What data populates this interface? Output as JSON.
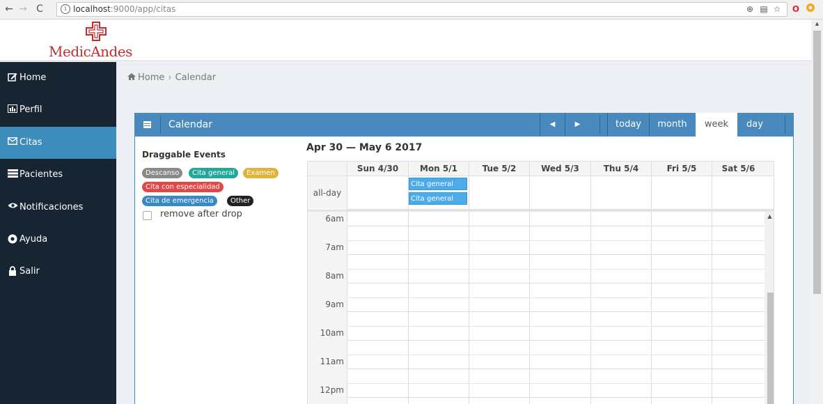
{
  "browser": {
    "url_host": "localhost",
    "url_path": ":9000/app/citas",
    "info_glyph": "i"
  },
  "brand": {
    "name": "MedicAndes",
    "accent_color": "#c42b2b"
  },
  "sidebar": {
    "items": [
      {
        "label": "Home",
        "icon": "edit-icon"
      },
      {
        "label": "Perfil",
        "icon": "bar-chart-icon"
      },
      {
        "label": "Citas",
        "icon": "envelope-icon",
        "active": true
      },
      {
        "label": "Pacientes",
        "icon": "list-icon"
      },
      {
        "label": "Notificaciones",
        "icon": "eye-icon"
      },
      {
        "label": "Ayuda",
        "icon": "life-ring-icon"
      },
      {
        "label": "Salir",
        "icon": "lock-icon"
      }
    ]
  },
  "breadcrumb": {
    "home": "Home",
    "separator": "›",
    "current": "Calendar"
  },
  "calendar_panel": {
    "title": "Calendar",
    "prev_glyph": "◀",
    "next_glyph": "▶",
    "today": "today",
    "month": "month",
    "week": "week",
    "day": "day",
    "active_view": "week",
    "header_color": "#4a89be"
  },
  "draggable": {
    "title": "Draggable Events",
    "events": [
      {
        "label": "Descanso",
        "color": "#8a8a8a"
      },
      {
        "label": "Cita general",
        "color": "#20a99a"
      },
      {
        "label": "Examen",
        "color": "#e0b43a"
      },
      {
        "label": "Cita con especialidad",
        "color": "#e04848"
      },
      {
        "label": "Cita de emergencia",
        "color": "#3a89c4"
      },
      {
        "label": "Other",
        "color": "#222222"
      }
    ],
    "remove_label": "remove after drop"
  },
  "calendar": {
    "range_title": "Apr 30 — May 6 2017",
    "days": [
      "Sun 4/30",
      "Mon 5/1",
      "Tue 5/2",
      "Wed 5/3",
      "Thu 5/4",
      "Fri 5/5",
      "Sat 5/6"
    ],
    "allday_label": "all-day",
    "allday_events": [
      {
        "day": "Mon 5/1",
        "label": "Cita general"
      },
      {
        "day": "Mon 5/1",
        "label": "Cita general"
      }
    ],
    "times": [
      "6am",
      "7am",
      "8am",
      "9am",
      "10am",
      "11am",
      "12pm"
    ]
  }
}
